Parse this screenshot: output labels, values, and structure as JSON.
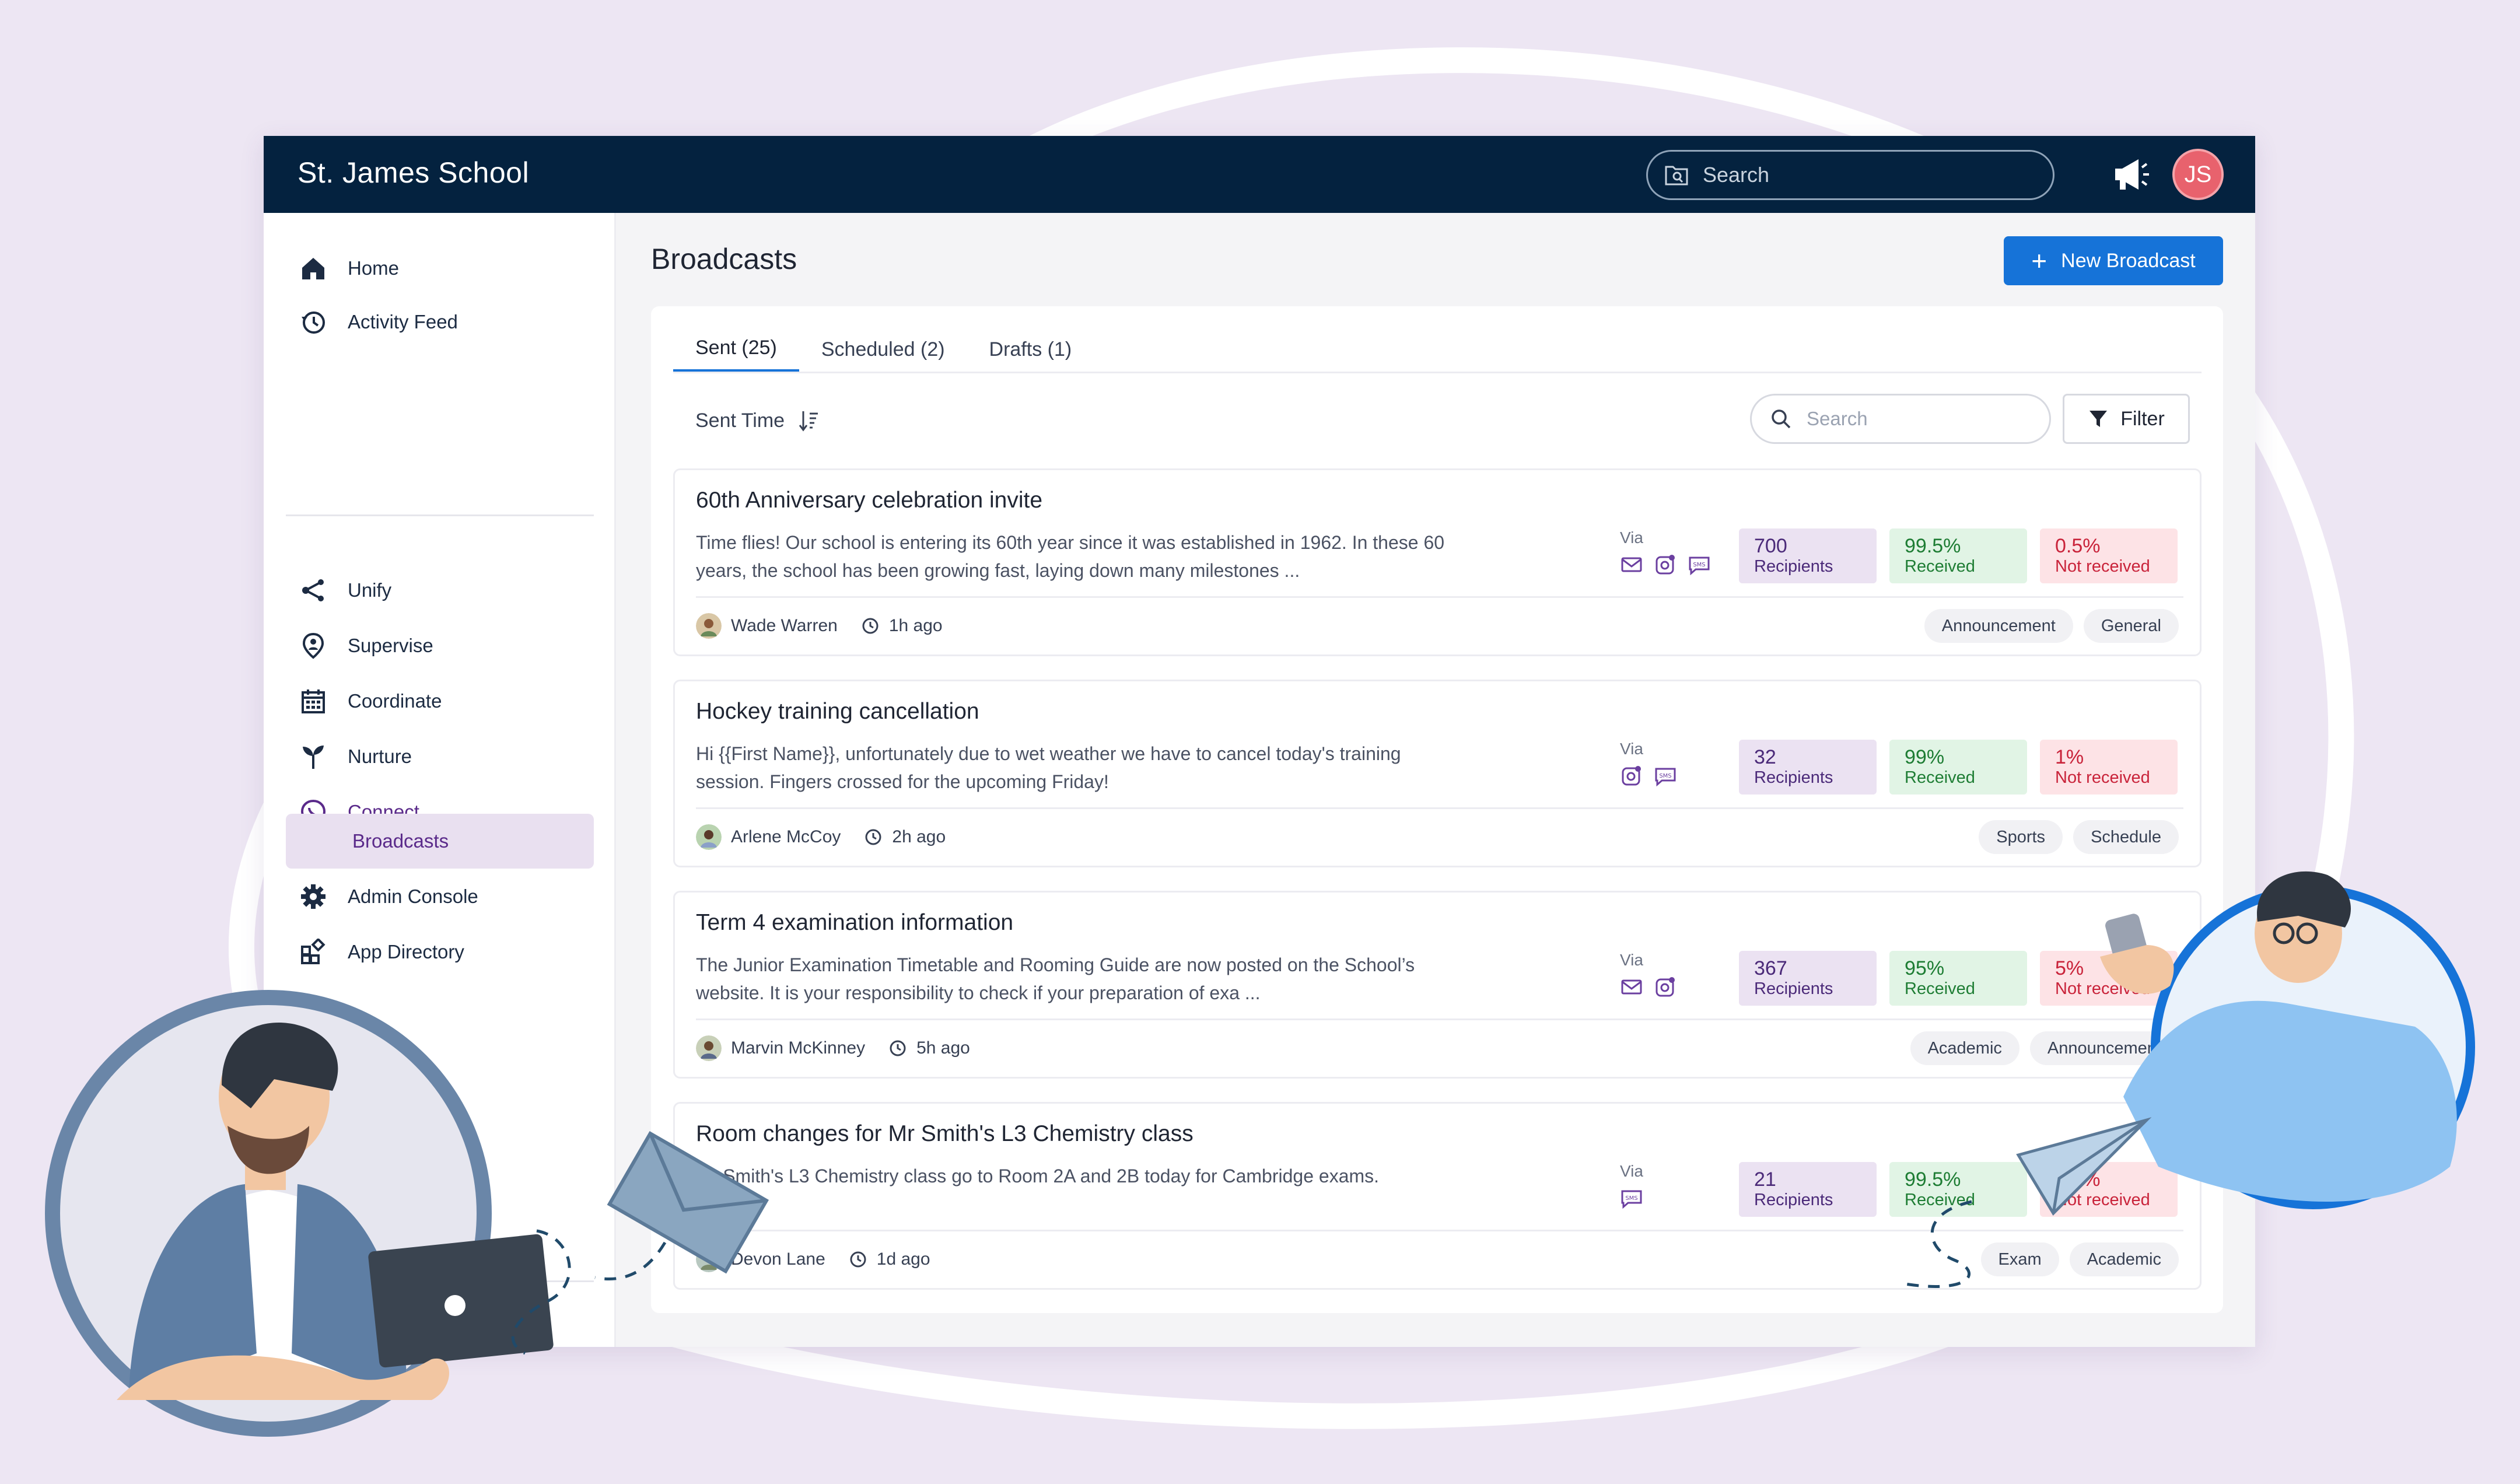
{
  "header": {
    "school_name": "St. James School",
    "search_placeholder": "Search",
    "avatar_initials": "JS"
  },
  "sidebar": {
    "items": [
      {
        "label": "Home",
        "icon": "home-icon"
      },
      {
        "label": "Activity Feed",
        "icon": "history-icon"
      },
      {
        "label": "Unify",
        "icon": "share-nodes-icon"
      },
      {
        "label": "Supervise",
        "icon": "location-pin-icon"
      },
      {
        "label": "Coordinate",
        "icon": "calendar-icon"
      },
      {
        "label": "Nurture",
        "icon": "sprout-icon"
      },
      {
        "label": "Connect",
        "icon": "chat-bubble-icon"
      },
      {
        "label": "Admin Console",
        "icon": "gear-icon"
      },
      {
        "label": "App Directory",
        "icon": "apps-grid-icon"
      }
    ],
    "active_sub": "Broadcasts"
  },
  "main": {
    "title": "Broadcasts",
    "new_button": "New Broadcast",
    "tabs": [
      {
        "label": "Sent (25)"
      },
      {
        "label": "Scheduled (2)"
      },
      {
        "label": "Drafts (1)"
      }
    ],
    "sort_label": "Sent Time",
    "search_placeholder": "Search",
    "filter_label": "Filter",
    "via_label": "Via",
    "broadcasts": [
      {
        "title": "60th Anniversary celebration invite",
        "body": "Time flies! Our school is entering its 60th year since it was established in 1962. In these 60 years, the school has been growing fast, laying down many milestones ...",
        "recipients": "700",
        "recipients_label": "Recipients",
        "received": "99.5%",
        "received_label": "Received",
        "not_received": "0.5%",
        "not_received_label": "Not received",
        "author": "Wade Warren",
        "time": "1h ago",
        "tags": [
          "Announcement",
          "General"
        ],
        "channels": [
          "email",
          "instagram",
          "sms"
        ]
      },
      {
        "title": "Hockey training cancellation",
        "body": "Hi {{First Name}}, unfortunately due to wet weather we have to cancel today's training session. Fingers crossed for the upcoming Friday!",
        "recipients": "32",
        "recipients_label": "Recipients",
        "received": "99%",
        "received_label": "Received",
        "not_received": "1%",
        "not_received_label": "Not received",
        "author": "Arlene McCoy",
        "time": "2h ago",
        "tags": [
          "Sports",
          "Schedule"
        ],
        "channels": [
          "instagram",
          "sms"
        ]
      },
      {
        "title": "Term 4 examination information",
        "body": "The Junior Examination Timetable and Rooming Guide are now posted on the School’s website. It is your responsibility to check if your preparation of exa ...",
        "recipients": "367",
        "recipients_label": "Recipients",
        "received": "95%",
        "received_label": "Received",
        "not_received": "5%",
        "not_received_label": "Not received",
        "author": "Marvin McKinney",
        "time": "5h ago",
        "tags": [
          "Academic",
          "Announcement"
        ],
        "channels": [
          "email",
          "instagram"
        ]
      },
      {
        "title": "Room changes for Mr Smith's L3 Chemistry class",
        "body": "Mr Smith's L3 Chemistry class go to Room 2A and 2B today for Cambridge exams.",
        "recipients": "21",
        "recipients_label": "Recipients",
        "received": "99.5%",
        "received_label": "Received",
        "not_received": "0.5%",
        "not_received_label": "Not received",
        "author": "Devon Lane",
        "time": "1d ago",
        "tags": [
          "Exam",
          "Academic"
        ],
        "channels": [
          "sms"
        ]
      }
    ]
  },
  "colors": {
    "topbar": "#04223f",
    "accent": "#1673d8",
    "brand_purple": "#5a2a8a",
    "background": "#ede6f3"
  }
}
